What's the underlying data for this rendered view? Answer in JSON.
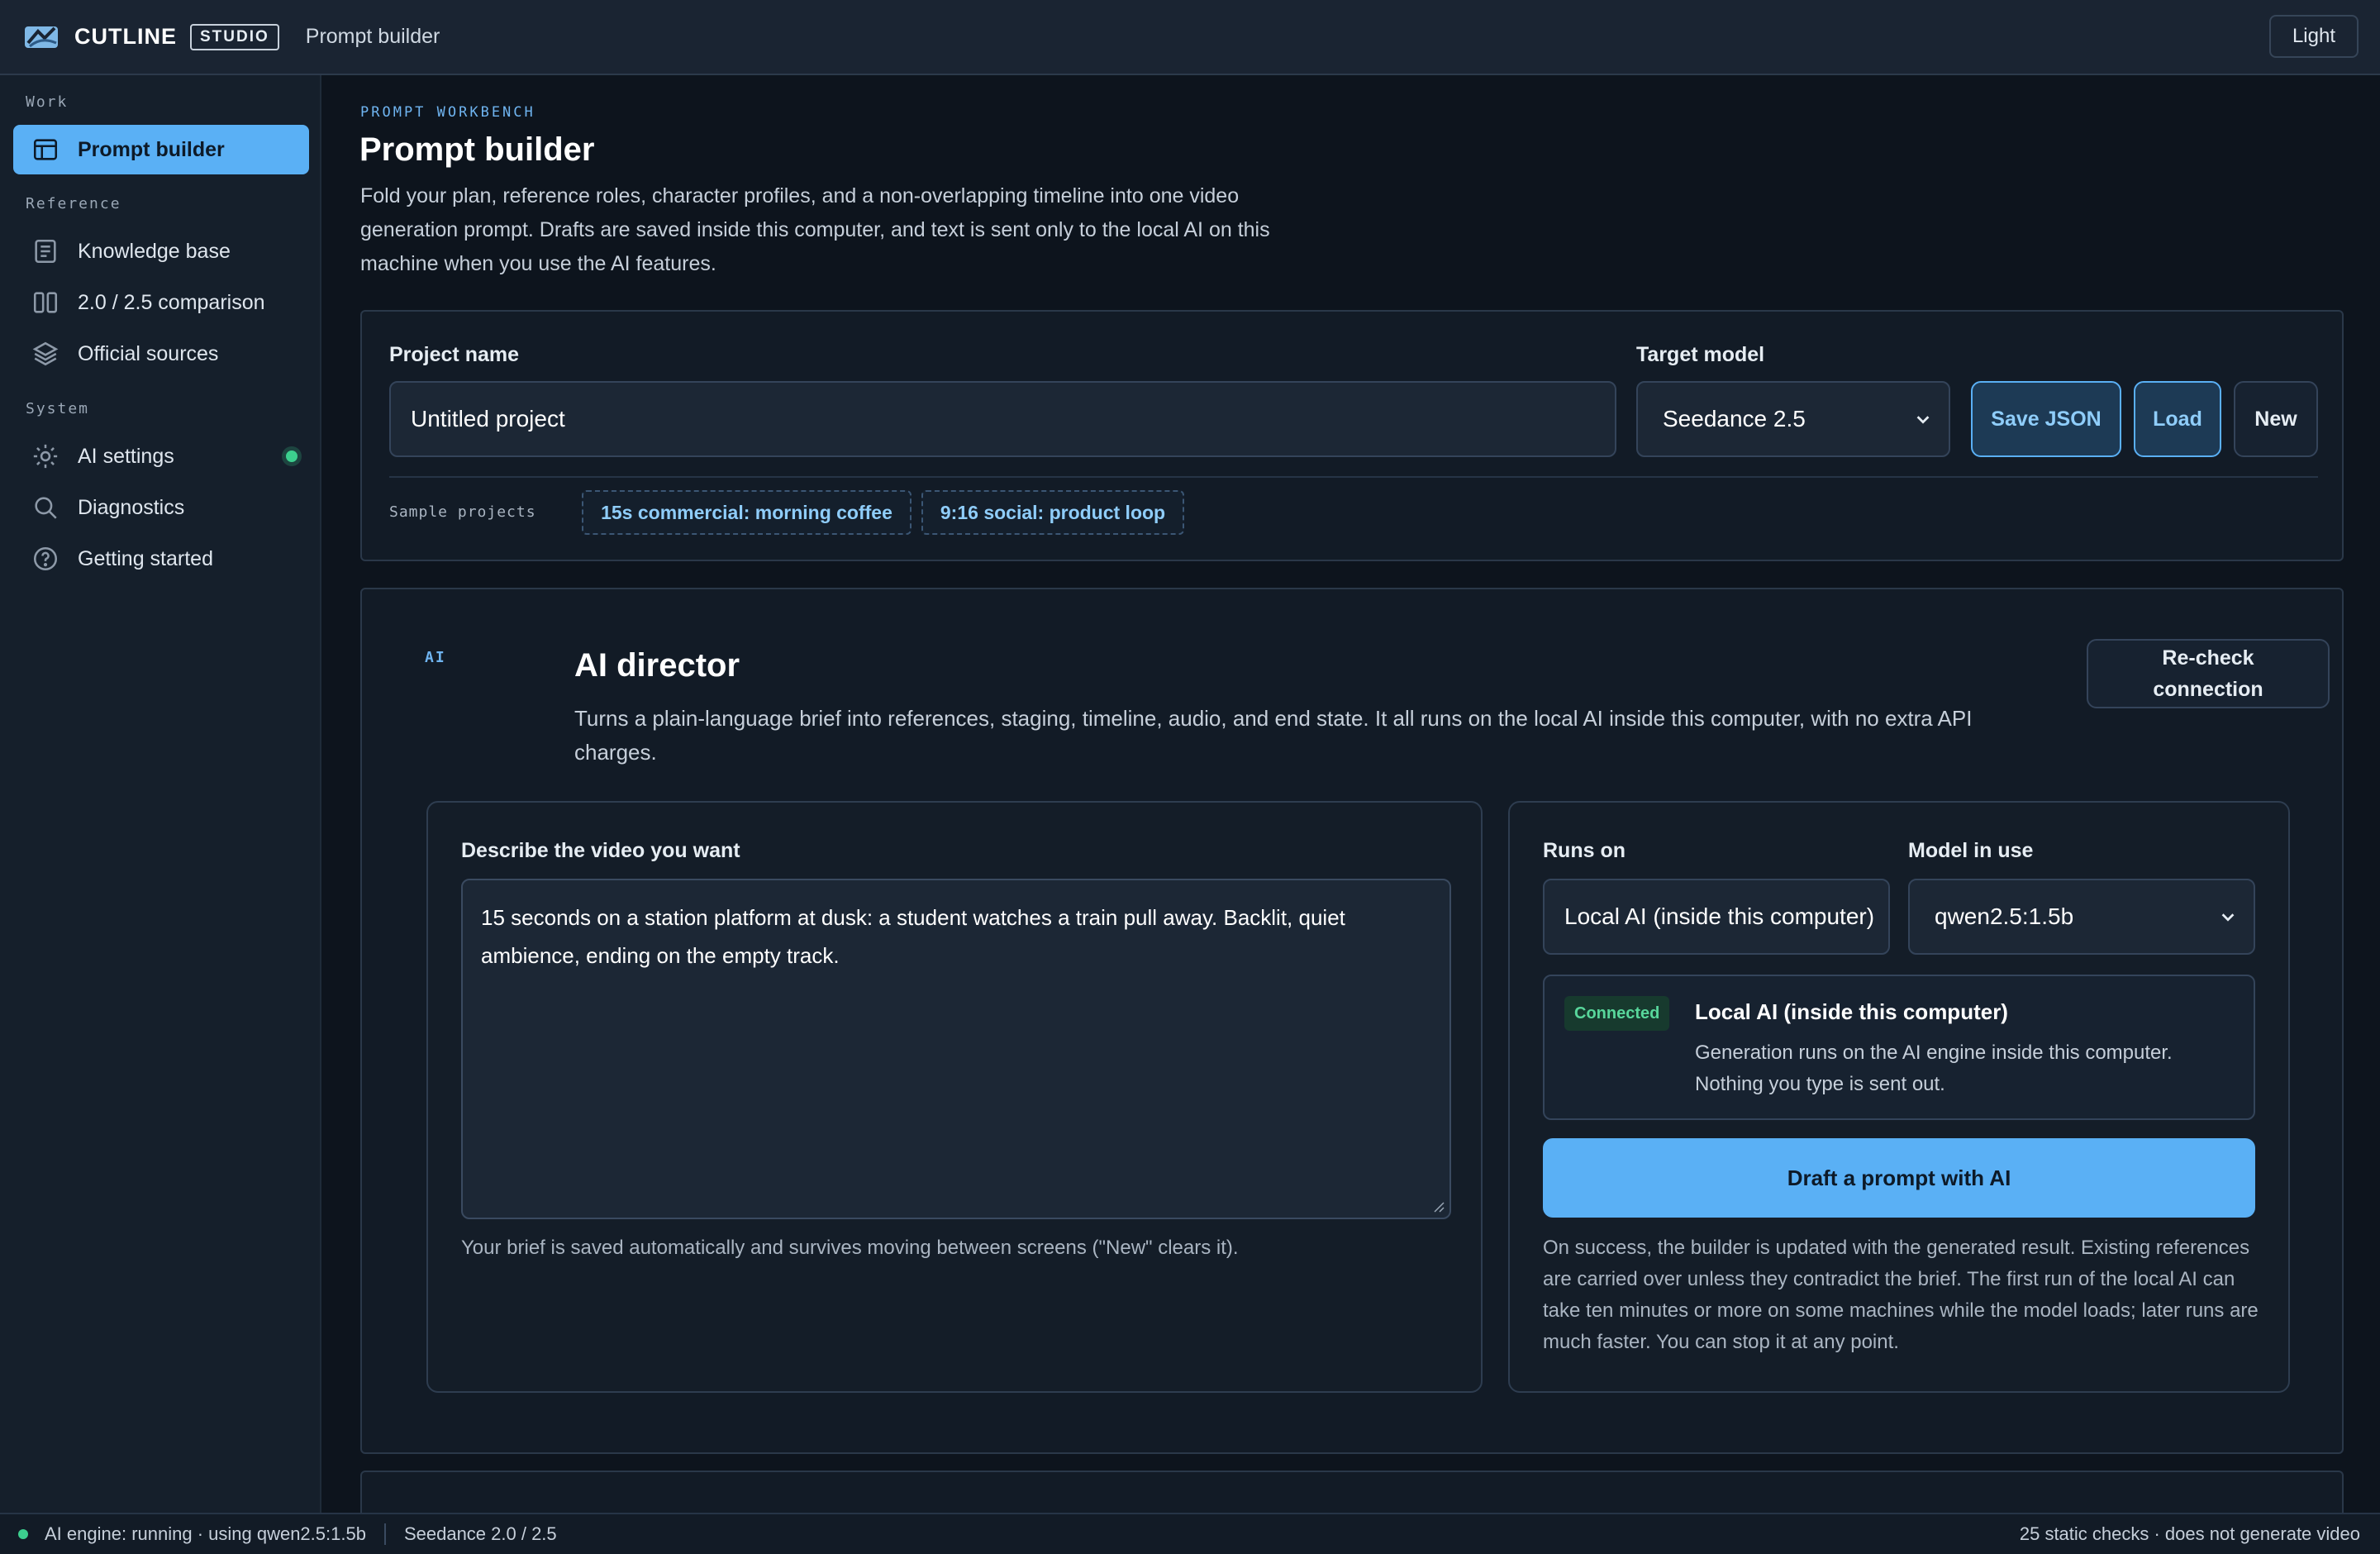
{
  "header": {
    "brand": "CUTLINE",
    "badge": "STUDIO",
    "page": "Prompt builder",
    "theme_button": "Light"
  },
  "sidebar": {
    "sections": [
      "Work",
      "Reference",
      "System"
    ],
    "items": [
      {
        "label": "Prompt builder",
        "icon": "layout-icon",
        "active": true
      },
      {
        "label": "Knowledge base",
        "icon": "document-icon"
      },
      {
        "label": "2.0 / 2.5 comparison",
        "icon": "columns-icon"
      },
      {
        "label": "Official sources",
        "icon": "layers-icon"
      },
      {
        "label": "AI settings",
        "icon": "gear-icon",
        "status": "online"
      },
      {
        "label": "Diagnostics",
        "icon": "search-icon"
      },
      {
        "label": "Getting started",
        "icon": "help-icon"
      }
    ]
  },
  "main": {
    "eyebrow": "PROMPT WORKBENCH",
    "title": "Prompt builder",
    "description": "Fold your plan, reference roles, character profiles, and a non-overlapping timeline into one video generation prompt. Drafts are saved inside this computer, and text is sent only to the local AI on this machine when you use the AI features."
  },
  "project": {
    "name_label": "Project name",
    "name_value": "Untitled project",
    "model_label": "Target model",
    "model_value": "Seedance 2.5",
    "save_button": "Save JSON",
    "load_button": "Load",
    "new_button": "New",
    "samples_label": "Sample projects",
    "samples": [
      "15s commercial: morning coffee",
      "9:16 social: product loop"
    ]
  },
  "director": {
    "tag": "AI",
    "title": "AI director",
    "description": "Turns a plain-language brief into references, staging, timeline, audio, and end state. It all runs on the local AI inside this computer, with no extra API charges.",
    "recheck_button": "Re-check connection",
    "brief_label": "Describe the video you want",
    "brief_value": "15 seconds on a station platform at dusk: a student watches a train pull away. Backlit, quiet ambience, ending on the empty track.",
    "brief_hint": "Your brief is saved automatically and survives moving between screens (\"New\" clears it).",
    "runs_on_label": "Runs on",
    "runs_on_value": "Local AI (inside this computer)",
    "model_in_use_label": "Model in use",
    "model_in_use_value": "qwen2.5:1.5b",
    "status_badge": "Connected",
    "status_title": "Local AI (inside this computer)",
    "status_text": "Generation runs on the AI engine inside this computer. Nothing you type is sent out.",
    "draft_button": "Draft a prompt with AI",
    "draft_hint": "On success, the builder is updated with the generated result. Existing references are carried over unless they contradict the brief. The first run of the local AI can take ten minutes or more on some machines while the model loads; later runs are much faster. You can stop it at any point."
  },
  "statusbar": {
    "engine": "AI engine: running · using qwen2.5:1.5b",
    "models": "Seedance 2.0 / 2.5",
    "right": "25 static checks · does not generate video"
  },
  "colors": {
    "accent": "#5ab0f5",
    "background": "#0d141d",
    "success": "#3ccf8e"
  }
}
